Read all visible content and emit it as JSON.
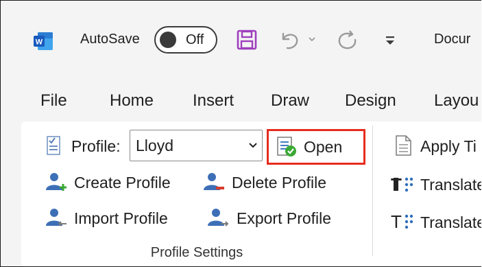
{
  "titlebar": {
    "app_icon": "word-icon",
    "autosave_label": "AutoSave",
    "autosave_state": "Off",
    "document_title": "Docur"
  },
  "tabs": [
    "File",
    "Home",
    "Insert",
    "Draw",
    "Design",
    "Layou"
  ],
  "ribbon": {
    "profile_label": "Profile:",
    "profile_value": "Lloyd",
    "open_label": "Open",
    "create_profile_label": "Create Profile",
    "delete_profile_label": "Delete Profile",
    "import_profile_label": "Import Profile",
    "export_profile_label": "Export  Profile",
    "group_label": "Profile Settings",
    "apply_label": "Apply Ti",
    "translate_1_label": "Translate",
    "translate_2_label": "Translate"
  },
  "colors": {
    "highlight": "#e62b1e",
    "word_blue": "#185abd",
    "save_purple": "#9e3fbd",
    "icon_blue": "#2e6fb8",
    "green_check": "#3aa935"
  }
}
